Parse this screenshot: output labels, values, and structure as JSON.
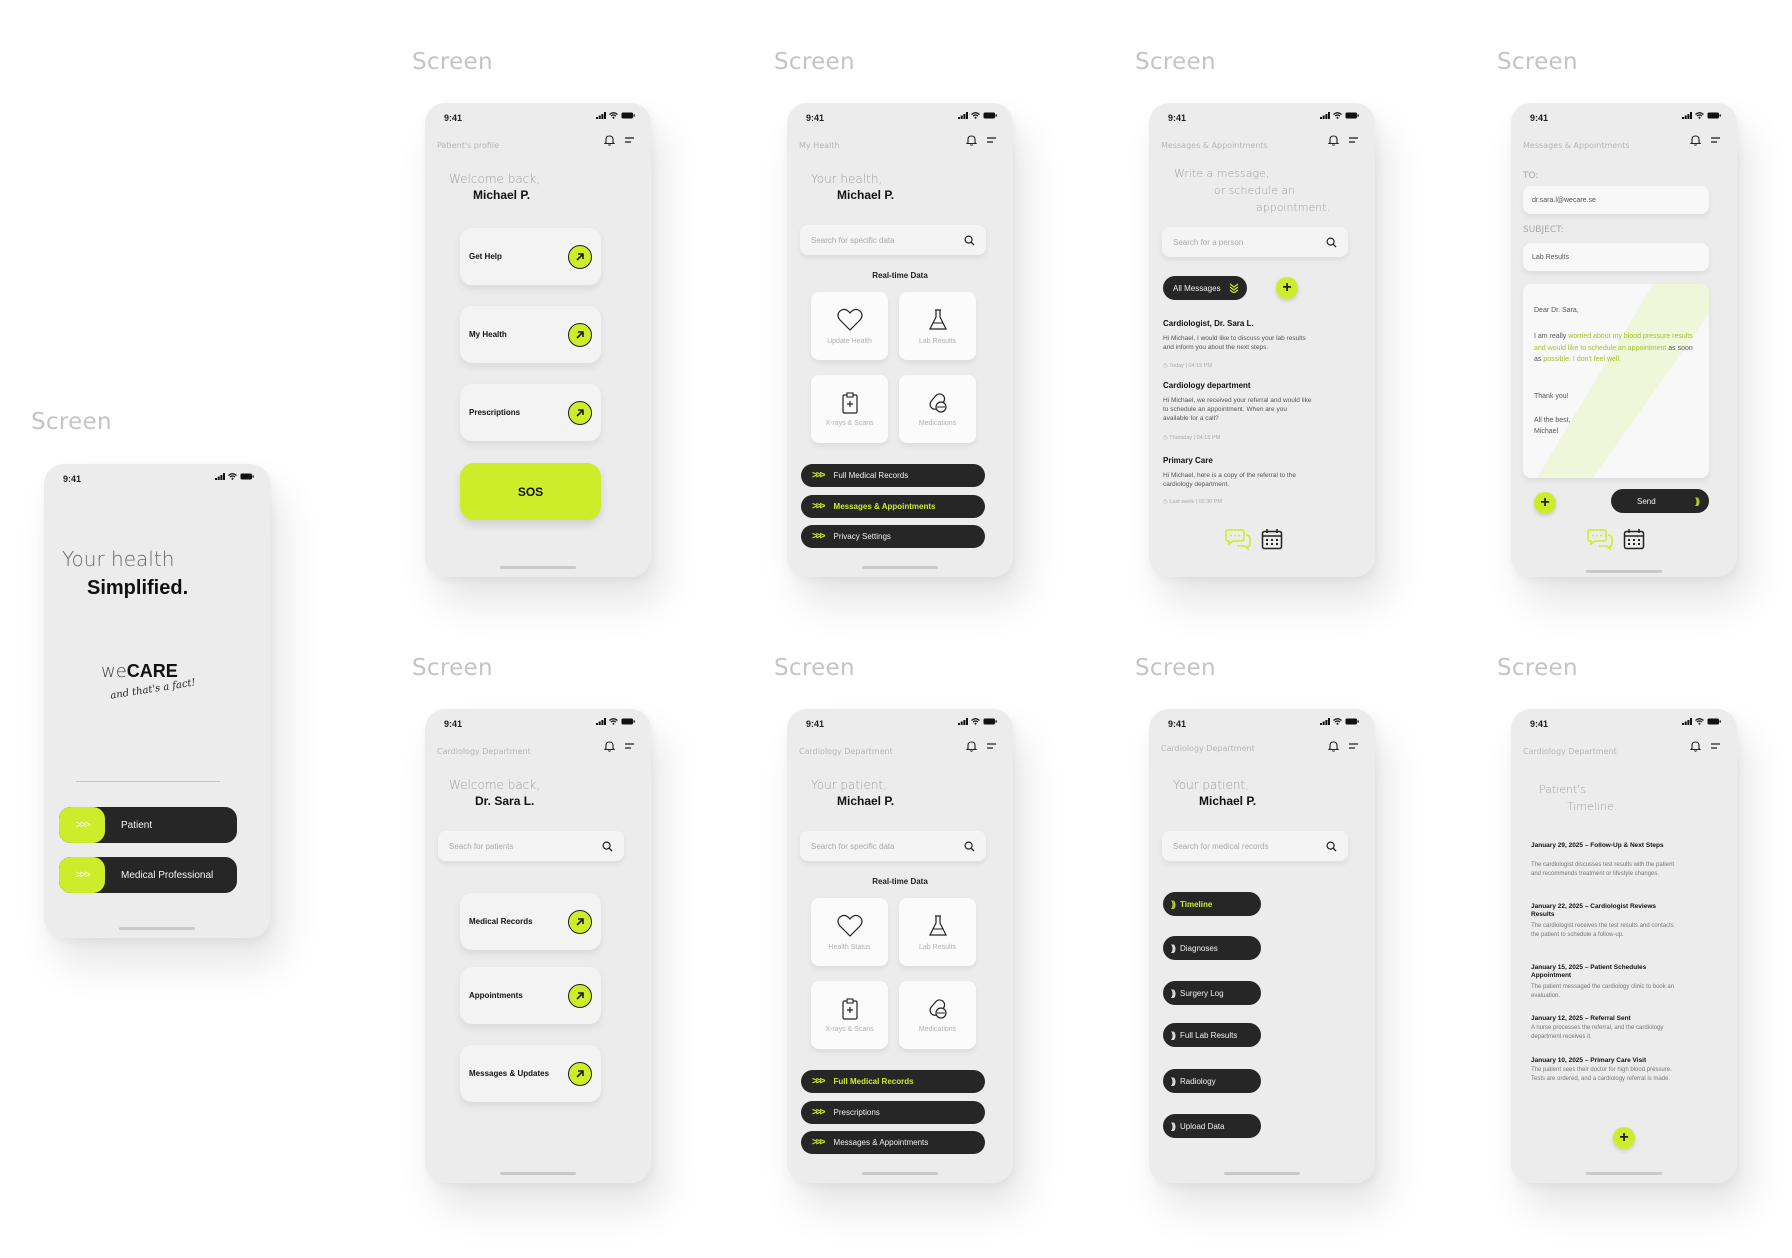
{
  "screen_label": "Screen",
  "status_time": "9:41",
  "colors": {
    "accent": "#cdec2a",
    "dark": "#262626",
    "phone_bg": "#ececec"
  },
  "landing": {
    "headline_1": "Your health",
    "headline_2": "Simplified.",
    "logo_we": "we",
    "logo_care": "CARE",
    "tagline": "and that's a fact!",
    "roles": [
      "Patient",
      "Medical Professional"
    ]
  },
  "patient_profile": {
    "context": "Patient's profile",
    "greeting": "Welcome back,",
    "name": "Michael P.",
    "cards": [
      "Get Help",
      "My Health",
      "Prescriptions"
    ],
    "sos": "SOS"
  },
  "my_health": {
    "context": "My Health",
    "greeting": "Your health,",
    "name": "Michael P.",
    "search_placeholder": "Search for specific data",
    "section": "Real-time Data",
    "tiles": [
      "Update Health",
      "Lab Results",
      "X-rays & Scans",
      "Medications"
    ],
    "pills": [
      "Full Medical Records",
      "Messages & Appointments",
      "Privacy Settings"
    ]
  },
  "messages": {
    "context": "Messages & Appointments",
    "intro": [
      "Write a message,",
      "or schedule an",
      "appointment."
    ],
    "search_placeholder": "Search for a person",
    "filter": "All Messages",
    "items": [
      {
        "title": "Cardiologist, Dr. Sara L.",
        "body": "Hi Michael, I would like to discuss your lab results and inform you about the next steps.",
        "time": "Today | 04:15 PM"
      },
      {
        "title": "Cardiology department",
        "body": "Hi Michael, we received your referral and would like to schedule an appointment. When are you available for a call?",
        "time": "Thursday | 04:15 PM"
      },
      {
        "title": "Primary Care",
        "body": "Hi Michael, here is a copy of the referral to the cardiology department.",
        "time": "Last week | 02:30 PM"
      }
    ]
  },
  "compose": {
    "context": "Messages & Appointments",
    "to_label": "TO:",
    "to_value": "dr.sara.l@wecare.se",
    "subject_label": "SUBJECT:",
    "subject_value": "Lab Results",
    "body_greeting": "Dear Dr. Sara,",
    "body_main_1": "I am really ",
    "body_hl_1": "worried about my blood pressure results and would like to schedule an appointment",
    "body_main_2": " as soon as ",
    "body_hl_2": "possible. I don't feel well.",
    "body_thanks": "Thank you!",
    "body_sign_1": "All the best,",
    "body_sign_2": "Michael",
    "send": "Send"
  },
  "doctor_home": {
    "context": "Cardiology Department",
    "greeting": "Welcome back,",
    "name": "Dr. Sara L.",
    "search_placeholder": "Seach for patients",
    "cards": [
      "Medical Records",
      "Appointments",
      "Messages & Updates"
    ]
  },
  "doctor_patient": {
    "context": "Cardiology Department",
    "greeting": "Your patient,",
    "name": "Michael P.",
    "search_placeholder": "Search for specific data",
    "section": "Real-time Data",
    "tiles": [
      "Health Status",
      "Lab Results",
      "X-rays & Scans",
      "Medications"
    ],
    "pills": [
      "Full Medical Records",
      "Prescriptions",
      "Messages & Appointments"
    ]
  },
  "records": {
    "context": "Cardiology Department",
    "greeting": "Your patient,",
    "name": "Michael P.",
    "search_placeholder": "Search for medical records",
    "pills": [
      "Timeline",
      "Diagnoses",
      "Surgery Log",
      "Full Lab Results",
      "Radiology",
      "Upload Data"
    ]
  },
  "timeline": {
    "context": "Cardiology Department",
    "title_1": "Patient's",
    "title_2": "Timeline.",
    "events": [
      {
        "title": "January 29, 2025 – Follow-Up & Next Steps",
        "body": "The cardiologist discusses test results with the patient and recommends treatment or lifestyle changes."
      },
      {
        "title": "January 22, 2025 – Cardiologist Reviews Results",
        "body": "The cardiologist receives the test results and contacts the patient to schedule a follow-up."
      },
      {
        "title": "January 15, 2025 – Patient Schedules Appointment",
        "body": "The patient messaged the cardiology clinic to book an evaluation."
      },
      {
        "title": "January 12, 2025 – Referral Sent",
        "body": "A nurse processes the referral, and the cardiology department receives it."
      },
      {
        "title": "January 10, 2025 – Primary Care Visit",
        "body": "The patient sees their doctor for high blood pressure. Tests are ordered, and a cardiology referral is made."
      }
    ]
  }
}
